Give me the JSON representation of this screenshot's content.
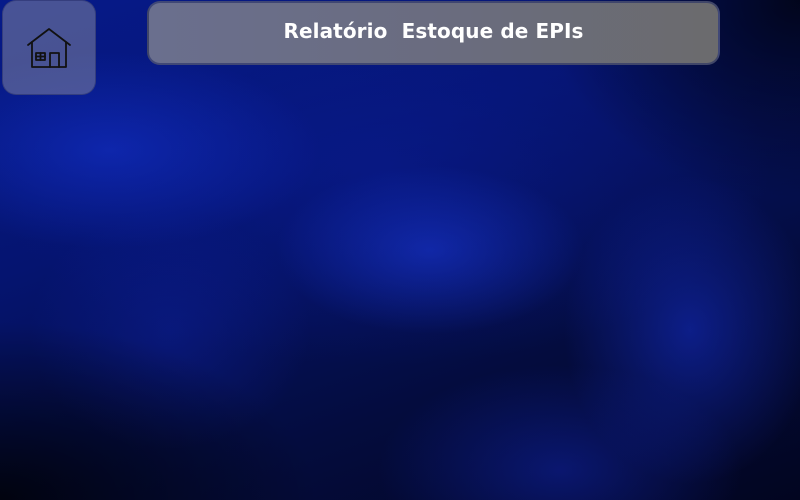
{
  "header": {
    "title": "Relatório  Estoque de EPIs"
  },
  "home_button": {
    "icon": "home-icon"
  },
  "colors": {
    "background": "#04105a",
    "title_bar": "#6a6c7e",
    "title_text": "#ffffff",
    "home_button": "#7d8098"
  }
}
